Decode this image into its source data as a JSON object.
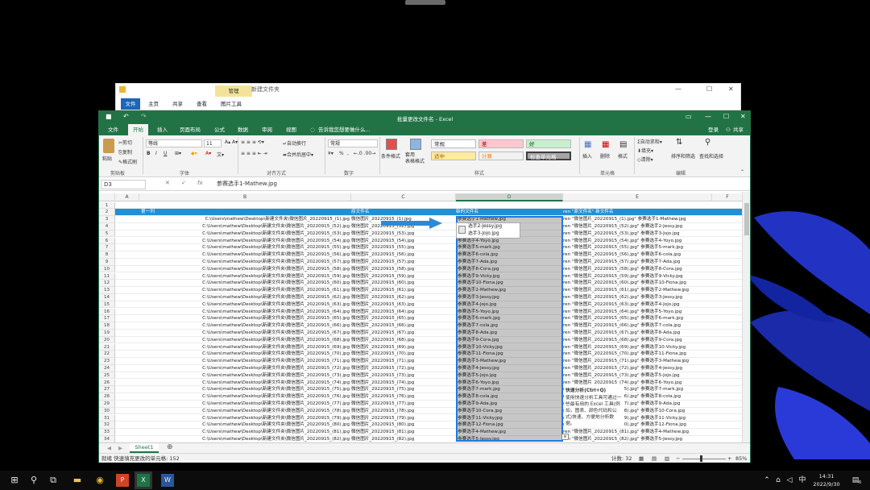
{
  "explorer": {
    "tool_tab": "管理",
    "path_title": "新建文件夹",
    "menus": [
      "文件",
      "主页",
      "共享",
      "查看",
      "图片工具"
    ]
  },
  "excel": {
    "title": "批量更改文件名 - Excel",
    "login": "登录",
    "share": "共享",
    "tabs": [
      "文件",
      "开始",
      "插入",
      "页面布局",
      "公式",
      "数据",
      "审阅",
      "视图"
    ],
    "active_tab": "开始",
    "tell_me": "告诉我您想要做什么...",
    "ribbon": {
      "clipboard": {
        "paste": "粘贴",
        "cut": "剪切",
        "copy": "复制",
        "format_painter": "格式刷",
        "group": "剪贴板"
      },
      "font": {
        "name": "等线",
        "size": "11",
        "group": "字体",
        "bold": "B",
        "italic": "I",
        "underline": "U"
      },
      "alignment": {
        "wrap": "自动换行",
        "merge": "合并后居中",
        "group": "对齐方式"
      },
      "number": {
        "format": "常规",
        "group": "数字",
        "percent": "%",
        "comma": ","
      },
      "styles": {
        "conditional": "条件格式",
        "table": "套用\n表格格式",
        "items": [
          {
            "label": "常规",
            "color": "#ffffff",
            "text": "#000000"
          },
          {
            "label": "差",
            "color": "#ffc7ce",
            "text": "#9c0006"
          },
          {
            "label": "好",
            "color": "#c6efce",
            "text": "#006100"
          },
          {
            "label": "适中",
            "color": "#ffeb9c",
            "text": "#9c5700"
          },
          {
            "label": "计算",
            "color": "#f2f2f2",
            "text": "#fa7d00"
          },
          {
            "label": "检查单元格",
            "color": "#a5a5a5",
            "text": "#ffffff"
          }
        ],
        "group": "样式"
      },
      "cells": {
        "insert": "插入",
        "delete": "删除",
        "format": "格式",
        "group": "单元格"
      },
      "editing": {
        "autosum": "自动求和",
        "fill": "填充",
        "clear": "清除",
        "sort": "排序和筛选",
        "find": "查找和选择",
        "group": "编辑"
      }
    },
    "namebox": "D3",
    "formula": "参赛选手1-Mathew.jpg",
    "columns": [
      "A",
      "B",
      "C",
      "D",
      "E",
      "F"
    ],
    "row_numbers": [
      "1",
      "2",
      "3",
      "4",
      "5",
      "6",
      "7",
      "8",
      "9",
      "10",
      "11",
      "12",
      "13",
      "14",
      "15",
      "16",
      "17",
      "18",
      "19",
      "20",
      "21",
      "22",
      "23",
      "24",
      "25",
      "26",
      "27",
      "28",
      "29",
      "30",
      "31",
      "32",
      "33",
      "34"
    ],
    "header_row": {
      "b": "第一列",
      "c": "原文件名",
      "d": "新的文件名",
      "e": "ren \"原文件名\" 新文件名"
    },
    "col_b_prefix": "C:\\Users\\mathew\\Desktop\\新建文件夹\\微信图片_20220915_",
    "col_c_prefix": "微信图片_20220915_",
    "file_numbers": [
      "(1).jpg",
      "(52).jpg",
      "(53).jpg",
      "(54).jpg",
      "(55).jpg",
      "(56).jpg",
      "(57).jpg",
      "(58).jpg",
      "(59).jpg",
      "(60).jpg",
      "(61).jpg",
      "(62).jpg",
      "(63).jpg",
      "(64).jpg",
      "(65).jpg",
      "(66).jpg",
      "(67).jpg",
      "(68).jpg",
      "(69).jpg",
      "(70).jpg",
      "(71).jpg",
      "(72).jpg",
      "(73).jpg",
      "(74).jpg",
      "(75).jpg",
      "(76).jpg",
      "(77).jpg",
      "(78).jpg",
      "(79).jpg",
      "(80).jpg",
      "(81).jpg",
      "(82).jpg"
    ],
    "new_names": [
      "参赛选手1-Mathew.jpg",
      "参赛选手2-Jessy.jpg",
      "参赛选手3-Jojo.jpg",
      "参赛选手4-Yoyo.jpg",
      "参赛选手5-mark.jpg",
      "参赛选手6-cola.jpg",
      "参赛选手7-Ada.jpg",
      "参赛选手8-Cora.jpg",
      "参赛选手9-Vicky.jpg",
      "参赛选手10-Fiona.jpg",
      "参赛选手2-Mathew.jpg",
      "参赛选手3-Jessy.jpg",
      "参赛选手4-Jojo.jpg",
      "参赛选手5-Yoyo.jpg",
      "参赛选手6-mark.jpg",
      "参赛选手7-cola.jpg",
      "参赛选手8-Ada.jpg",
      "参赛选手9-Cora.jpg",
      "参赛选手10-Vicky.jpg",
      "参赛选手11-Fiona.jpg",
      "参赛选手3-Mathew.jpg",
      "参赛选手4-Jessy.jpg",
      "参赛选手5-Jojo.jpg",
      "参赛选手6-Yoyo.jpg",
      "参赛选手7-mark.jpg",
      "参赛选手8-cola.jpg",
      "参赛选手9-Ada.jpg",
      "参赛选手10-Cora.jpg",
      "参赛选手11-Vicky.jpg",
      "参赛选手12-Fiona.jpg",
      "参赛选手4-Mathew.jpg",
      "参赛选手5-Jessy.jpg"
    ],
    "popup_items": [
      "选手2-Jessy.jpg",
      "选手3-Jojo.jpg"
    ],
    "quick_analysis": {
      "title": "快速分析(Ctrl+Q)",
      "body": "使用快速分析工具可通过一些最有用的 Excel 工具(例如，图表、颜色代码和公式)快速、方便地分析数据。"
    },
    "sheet_tab": "Sheet1",
    "status_left": "就绪  快速填充更改的单元格: 152",
    "status_count": "计数: 32",
    "zoom": "85%"
  },
  "taskbar": {
    "ime": "中",
    "time": "14:31",
    "date": "2022/9/30",
    "notif": "6"
  }
}
